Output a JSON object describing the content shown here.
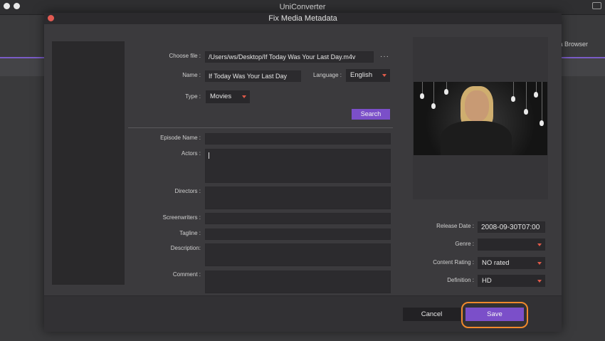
{
  "app": {
    "title": "UniConverter",
    "background_tab": "a Browser"
  },
  "dialog": {
    "title": "Fix Media Metadata",
    "choose_file": {
      "label": "Choose file :",
      "value": "/Users/ws/Desktop/If Today Was Your Last Day.m4v",
      "more": "···"
    },
    "name": {
      "label": "Name :",
      "value": "If Today Was Your Last Day"
    },
    "language": {
      "label": "Language :",
      "value": "English"
    },
    "type": {
      "label": "Type :",
      "value": "Movies"
    },
    "search_button": "Search",
    "episode_name": {
      "label": "Episode Name :",
      "value": ""
    },
    "actors": {
      "label": "Actors :",
      "value": ""
    },
    "directors": {
      "label": "Directors :",
      "value": ""
    },
    "screenwriters": {
      "label": "Screenwriters :",
      "value": ""
    },
    "tagline": {
      "label": "Tagline :",
      "value": ""
    },
    "description": {
      "label": "Description:",
      "value": ""
    },
    "comment": {
      "label": "Comment :",
      "value": ""
    },
    "release_date": {
      "label": "Release Date :",
      "value": "2008-09-30T07:00"
    },
    "genre": {
      "label": "Genre :",
      "value": ""
    },
    "content_rating": {
      "label": "Content Rating :",
      "value": "NO rated"
    },
    "definition": {
      "label": "Definition :",
      "value": "HD"
    },
    "cancel_button": "Cancel",
    "save_button": "Save"
  },
  "colors": {
    "accent": "#7b4fc9",
    "highlight": "#f0892c",
    "close": "#e25a52"
  }
}
